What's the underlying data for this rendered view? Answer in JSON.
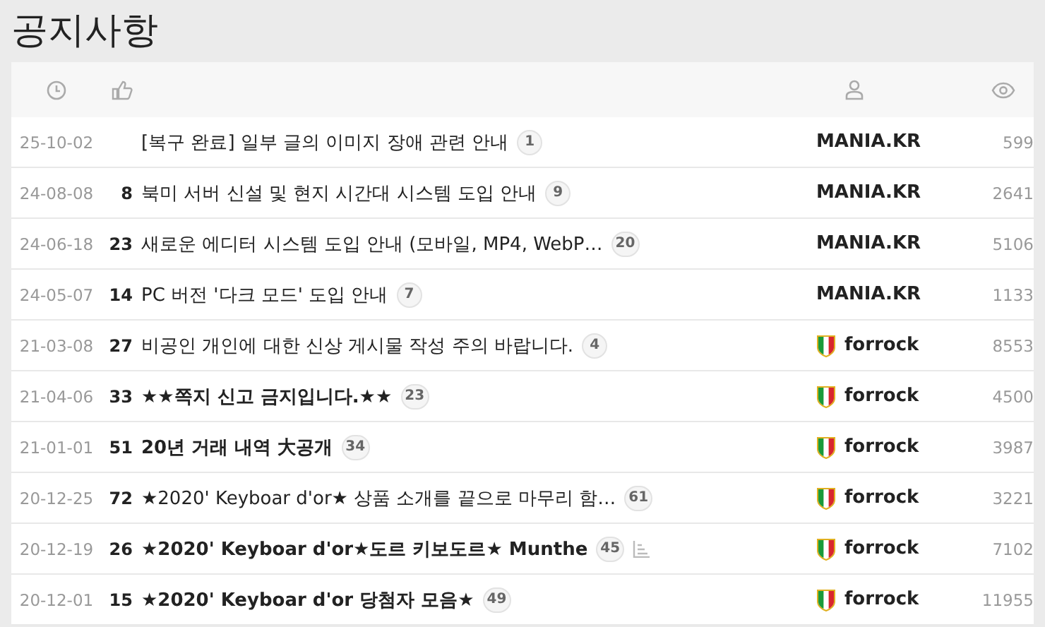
{
  "page_title": "공지사항",
  "rows": [
    {
      "date": "25-10-02",
      "title": "[복구 완료] 일부 글의 이미지 장애 관련 안내",
      "bold": false,
      "comments": "1",
      "author": "MANIA.KR",
      "shield": false,
      "views": "599",
      "attachment": false
    },
    {
      "date": "24-08-08",
      "likes": "8",
      "title": "북미 서버 신설 및 현지 시간대 시스템 도입 안내",
      "bold": false,
      "comments": "9",
      "author": "MANIA.KR",
      "shield": false,
      "views": "2641",
      "attachment": false
    },
    {
      "date": "24-06-18",
      "likes": "23",
      "title": "새로운 에디터 시스템 도입 안내 (모바일, MP4, WebP…",
      "bold": false,
      "comments": "20",
      "author": "MANIA.KR",
      "shield": false,
      "views": "5106",
      "attachment": false
    },
    {
      "date": "24-05-07",
      "likes": "14",
      "title": "PC 버전 '다크 모드' 도입 안내",
      "bold": false,
      "comments": "7",
      "author": "MANIA.KR",
      "shield": false,
      "views": "1133",
      "attachment": false
    },
    {
      "date": "21-03-08",
      "likes": "27",
      "title": "비공인 개인에 대한 신상 게시물 작성 주의 바랍니다.",
      "bold": false,
      "comments": "4",
      "author": "forrock",
      "shield": true,
      "views": "8553",
      "attachment": false
    },
    {
      "date": "21-04-06",
      "likes": "33",
      "title": "★★쪽지 신고 금지입니다.★★",
      "bold": true,
      "comments": "23",
      "author": "forrock",
      "shield": true,
      "views": "4500",
      "attachment": false
    },
    {
      "date": "21-01-01",
      "likes": "51",
      "title": "20년 거래 내역 大공개",
      "bold": true,
      "comments": "34",
      "author": "forrock",
      "shield": true,
      "views": "3987",
      "attachment": false
    },
    {
      "date": "20-12-25",
      "likes": "72",
      "title": "★2020' Keyboar d'or★ 상품 소개를 끝으로 마무리 함…",
      "bold": false,
      "comments": "61",
      "author": "forrock",
      "shield": true,
      "views": "3221",
      "attachment": false
    },
    {
      "date": "20-12-19",
      "likes": "26",
      "title": "★2020' Keyboar d'or★도르 키보도르★ Munthe",
      "bold": true,
      "comments": "45",
      "author": "forrock",
      "shield": true,
      "views": "7102",
      "attachment": true
    },
    {
      "date": "20-12-01",
      "likes": "15",
      "title": "★2020' Keyboar d'or 당첨자 모음★",
      "bold": true,
      "comments": "49",
      "author": "forrock",
      "shield": true,
      "views": "11955",
      "attachment": false
    }
  ]
}
